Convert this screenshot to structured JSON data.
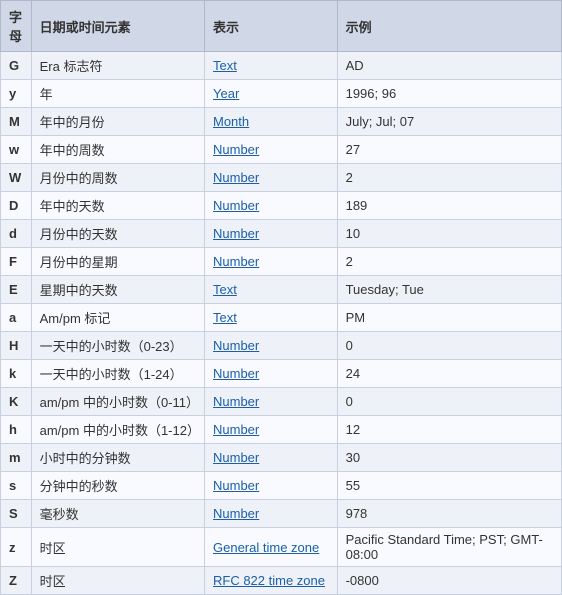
{
  "table": {
    "headers": [
      "字母",
      "日期或时间元素",
      "表示",
      "示例"
    ],
    "rows": [
      {
        "char": "G",
        "desc": "Era 标志符",
        "rep": "Text",
        "rep_link": true,
        "example": "AD"
      },
      {
        "char": "y",
        "desc": "年",
        "rep": "Year",
        "rep_link": true,
        "example": "1996; 96"
      },
      {
        "char": "M",
        "desc": "年中的月份",
        "rep": "Month",
        "rep_link": true,
        "example": "July; Jul; 07"
      },
      {
        "char": "w",
        "desc": "年中的周数",
        "rep": "Number",
        "rep_link": true,
        "example": "27"
      },
      {
        "char": "W",
        "desc": "月份中的周数",
        "rep": "Number",
        "rep_link": true,
        "example": "2"
      },
      {
        "char": "D",
        "desc": "年中的天数",
        "rep": "Number",
        "rep_link": true,
        "example": "189"
      },
      {
        "char": "d",
        "desc": "月份中的天数",
        "rep": "Number",
        "rep_link": true,
        "example": "10"
      },
      {
        "char": "F",
        "desc": "月份中的星期",
        "rep": "Number",
        "rep_link": true,
        "example": "2"
      },
      {
        "char": "E",
        "desc": "星期中的天数",
        "rep": "Text",
        "rep_link": true,
        "example": "Tuesday; Tue"
      },
      {
        "char": "a",
        "desc": "Am/pm 标记",
        "rep": "Text",
        "rep_link": true,
        "example": "PM"
      },
      {
        "char": "H",
        "desc": "一天中的小时数（0-23）",
        "rep": "Number",
        "rep_link": true,
        "example": "0"
      },
      {
        "char": "k",
        "desc": "一天中的小时数（1-24）",
        "rep": "Number",
        "rep_link": true,
        "example": "24"
      },
      {
        "char": "K",
        "desc": "am/pm 中的小时数（0-11）",
        "rep": "Number",
        "rep_link": true,
        "example": "0"
      },
      {
        "char": "h",
        "desc": "am/pm 中的小时数（1-12）",
        "rep": "Number",
        "rep_link": true,
        "example": "12"
      },
      {
        "char": "m",
        "desc": "小时中的分钟数",
        "rep": "Number",
        "rep_link": true,
        "example": "30"
      },
      {
        "char": "s",
        "desc": "分钟中的秒数",
        "rep": "Number",
        "rep_link": true,
        "example": "55"
      },
      {
        "char": "S",
        "desc": "毫秒数",
        "rep": "Number",
        "rep_link": true,
        "example": "978"
      },
      {
        "char": "z",
        "desc": "时区",
        "rep": "General time zone",
        "rep_link": true,
        "example": "Pacific Standard Time; PST; GMT-08:00"
      },
      {
        "char": "Z",
        "desc": "时区",
        "rep": "RFC 822 time zone",
        "rep_link": true,
        "example": "-0800"
      }
    ]
  }
}
